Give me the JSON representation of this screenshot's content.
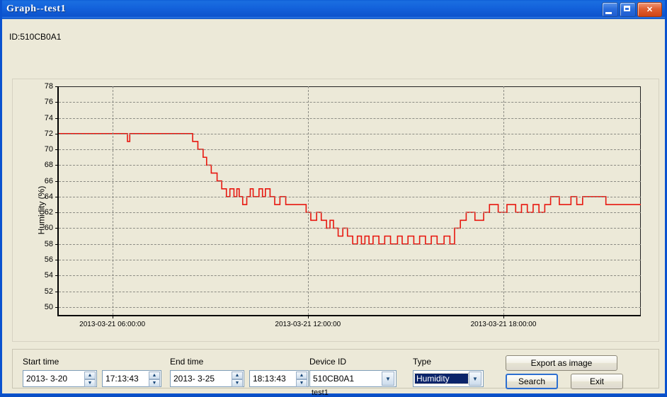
{
  "window": {
    "title": "Graph--test1",
    "buttons": {
      "minimize": "minimize-button",
      "maximize": "maximize-button",
      "close": "✕"
    }
  },
  "header": {
    "id_label": "ID:510CB0A1"
  },
  "controls": {
    "start_time_label": "Start time",
    "start_date_value": "2013-  3-20",
    "start_clock_value": "17:13:43",
    "end_time_label": "End time",
    "end_date_value": "2013-  3-25",
    "end_clock_value": "18:13:43",
    "device_id_label": "Device ID",
    "device_id_value": "510CB0A1",
    "device_name": "test1",
    "type_label": "Type",
    "type_value": "Humidity",
    "export_button": "Export as image",
    "search_button": "Search",
    "exit_button": "Exit",
    "spinner_up": "▲",
    "spinner_down": "▼",
    "combo_arrow": "▼"
  },
  "colors": {
    "title_bar": "#1463dc",
    "series": "#e8170f",
    "plot_background": "#ece9d8",
    "gridline": "#8c8c84",
    "window_border": "#0a52cf",
    "select_highlight": "#0a246a"
  },
  "chart_data": {
    "type": "line",
    "title": "",
    "xlabel": "",
    "ylabel": "Humidity (%)",
    "ylim": [
      49,
      78
    ],
    "yticks": [
      78,
      76,
      74,
      72,
      70,
      68,
      66,
      64,
      62,
      60,
      58,
      56,
      54,
      52,
      50
    ],
    "grid": true,
    "legend": "none",
    "xlim": [
      0,
      100
    ],
    "xticks": [
      9.2,
      42.8,
      76.4
    ],
    "xticklabels": [
      "2013-03-21 06:00:00",
      "2013-03-21 12:00:00",
      "2013-03-21 18:00:00"
    ],
    "series": [
      {
        "name": "Humidity",
        "color": "#e8170f",
        "step": "post",
        "x": [
          0.0,
          11.8,
          11.8,
          12.2,
          12.2,
          23.0,
          23.0,
          23.9,
          23.9,
          24.8,
          24.8,
          25.4,
          25.4,
          26.2,
          26.2,
          27.2,
          27.2,
          28.0,
          28.0,
          28.8,
          28.8,
          29.4,
          29.4,
          30.1,
          30.1,
          30.6,
          30.6,
          31.0,
          31.0,
          31.6,
          31.6,
          32.3,
          32.3,
          32.9,
          32.9,
          33.4,
          33.4,
          34.4,
          34.4,
          35.0,
          35.0,
          35.5,
          35.5,
          36.3,
          36.3,
          37.1,
          37.1,
          38.0,
          38.0,
          39.0,
          39.0,
          42.5,
          42.5,
          43.3,
          43.3,
          44.3,
          44.3,
          45.1,
          45.1,
          46.0,
          46.0,
          46.6,
          46.6,
          47.2,
          47.2,
          48.0,
          48.0,
          48.8,
          48.8,
          49.6,
          49.6,
          50.5,
          50.5,
          51.3,
          51.3,
          52.0,
          52.0,
          52.6,
          52.6,
          53.3,
          53.3,
          54.0,
          54.0,
          55.0,
          55.0,
          56.0,
          56.0,
          57.0,
          57.0,
          58.2,
          58.2,
          59.0,
          59.0,
          60.0,
          60.0,
          61.0,
          61.0,
          62.0,
          62.0,
          63.0,
          63.0,
          64.0,
          64.0,
          65.0,
          65.0,
          66.2,
          66.2,
          67.2,
          67.2,
          68.0,
          68.0,
          69.0,
          69.0,
          70.0,
          70.0,
          71.5,
          71.5,
          73.0,
          73.0,
          74.0,
          74.0,
          75.5,
          75.5,
          77.0,
          77.0,
          78.5,
          78.5,
          79.5,
          79.5,
          80.5,
          80.5,
          81.5,
          81.5,
          82.5,
          82.5,
          83.5,
          83.5,
          84.5,
          84.5,
          86.0,
          86.0,
          88.0,
          88.0,
          89.0,
          89.0,
          90.0,
          90.0,
          94.0,
          94.0,
          100.0
        ],
        "y": [
          72,
          72,
          71,
          71,
          72,
          72,
          71,
          71,
          70,
          70,
          69,
          69,
          68,
          68,
          67,
          67,
          66,
          66,
          65,
          65,
          64,
          64,
          65,
          65,
          64,
          64,
          65,
          65,
          64,
          64,
          63,
          63,
          64,
          64,
          65,
          65,
          64,
          64,
          65,
          65,
          64,
          64,
          65,
          65,
          64,
          64,
          63,
          63,
          64,
          64,
          63,
          63,
          62,
          62,
          61,
          61,
          62,
          62,
          61,
          61,
          60,
          60,
          61,
          61,
          60,
          60,
          59,
          59,
          60,
          60,
          59,
          59,
          58,
          58,
          59,
          59,
          58,
          58,
          59,
          59,
          58,
          58,
          59,
          59,
          58,
          58,
          59,
          59,
          58,
          58,
          59,
          59,
          58,
          58,
          59,
          59,
          58,
          58,
          59,
          59,
          58,
          58,
          59,
          59,
          58,
          58,
          59,
          59,
          58,
          58,
          60,
          60,
          61,
          61,
          62,
          62,
          61,
          61,
          62,
          62,
          63,
          63,
          62,
          62,
          63,
          63,
          62,
          62,
          63,
          63,
          62,
          62,
          63,
          63,
          62,
          62,
          63,
          63,
          64,
          64,
          63,
          63,
          64,
          64,
          63,
          63,
          64,
          64,
          63,
          63,
          64,
          64
        ]
      }
    ]
  }
}
